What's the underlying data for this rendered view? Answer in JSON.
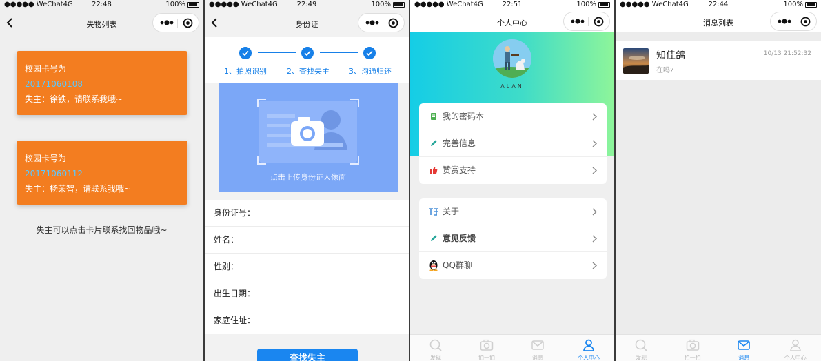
{
  "status": {
    "carrier": "●●●●● WeChat4G",
    "battery_pct": "100%",
    "times": [
      "22:48",
      "22:49",
      "22:51",
      "22:44"
    ]
  },
  "lost_list": {
    "title": "失物列表",
    "cards": [
      {
        "heading": "校园卡号为",
        "number": "20171060108",
        "owner": "失主：徐铁，请联系我哦~"
      },
      {
        "heading": "校园卡号为",
        "number": "20171060112",
        "owner": "失主：杨荣智，请联系我哦~"
      }
    ],
    "hint": "失主可以点击卡片联系找回物品哦~"
  },
  "id_card": {
    "title": "身份证",
    "steps": [
      "1、拍照识别",
      "2、查找失主",
      "3、沟通归还"
    ],
    "upload_text": "点击上传身份证人像面",
    "fields": [
      "身份证号：",
      "姓名：",
      "性别：",
      "出生日期：",
      "家庭住址："
    ],
    "submit_label": "查找失主"
  },
  "profile": {
    "title": "个人中心",
    "username": "ALAN",
    "menu_group_1": [
      {
        "label": "我的密码本",
        "icon": "notebook-icon",
        "color": "#4caf50"
      },
      {
        "label": "完善信息",
        "icon": "pencil-icon",
        "color": "#26a69a"
      },
      {
        "label": "赞赏支持",
        "icon": "thumbs-up-icon",
        "color": "#e53935"
      }
    ],
    "menu_group_2": [
      {
        "label": "关于",
        "icon": "info-icon",
        "color": "#4a90d9"
      },
      {
        "label": "意见反馈",
        "icon": "pencil-icon",
        "color": "#26a69a"
      },
      {
        "label": "QQ群聊",
        "icon": "qq-penguin-icon",
        "color": "#111111"
      }
    ]
  },
  "messages": {
    "title": "消息列表",
    "items": [
      {
        "name": "知佳鸽",
        "preview": "在吗?",
        "time": "10/13 21:52:32"
      }
    ]
  },
  "tabbar": {
    "tabs": [
      {
        "label": "发现",
        "icon": "discover-icon"
      },
      {
        "label": "拍一拍",
        "icon": "camera-icon"
      },
      {
        "label": "消息",
        "icon": "message-icon"
      },
      {
        "label": "个人中心",
        "icon": "person-icon"
      }
    ]
  },
  "colors": {
    "accent_blue": "#1a86f0",
    "card_orange": "#f37d20",
    "card_number_blue": "#5ac8ff",
    "upload_blue": "#7ba7f7"
  }
}
